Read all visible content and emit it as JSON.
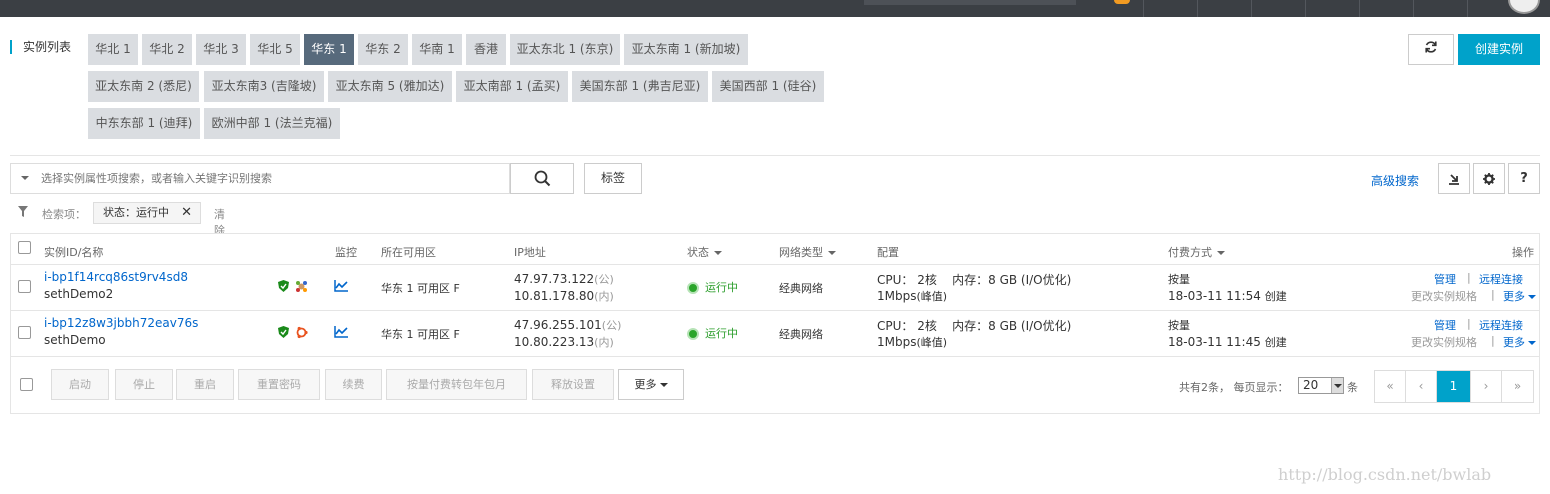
{
  "page_title": "实例列表",
  "regions": [
    {
      "label": "华北 1",
      "active": false
    },
    {
      "label": "华北 2",
      "active": false
    },
    {
      "label": "华北 3",
      "active": false
    },
    {
      "label": "华北 5",
      "active": false
    },
    {
      "label": "华东 1",
      "active": true
    },
    {
      "label": "华东 2",
      "active": false
    },
    {
      "label": "华南 1",
      "active": false
    },
    {
      "label": "香港",
      "active": false
    },
    {
      "label": "亚太东北 1 (东京)",
      "active": false
    },
    {
      "label": "亚太东南 1 (新加坡)",
      "active": false
    },
    {
      "label": "亚太东南 2 (悉尼)",
      "active": false
    },
    {
      "label": "亚太东南3 (吉隆坡)",
      "active": false
    },
    {
      "label": "亚太东南 5 (雅加达)",
      "active": false
    },
    {
      "label": "亚太南部 1 (孟买)",
      "active": false
    },
    {
      "label": "美国东部 1 (弗吉尼亚)",
      "active": false
    },
    {
      "label": "美国西部 1 (硅谷)",
      "active": false
    },
    {
      "label": "中东东部 1 (迪拜)",
      "active": false
    },
    {
      "label": "欧洲中部 1 (法兰克福)",
      "active": false
    }
  ],
  "actions": {
    "create": "创建实例",
    "refresh_icon": "refresh-icon"
  },
  "search": {
    "placeholder": "选择实例属性项搜索，或者输入关键字识别搜索",
    "tag_label": "标签",
    "advanced": "高级搜索"
  },
  "filter": {
    "label": "检索项：",
    "chip": "状态：运行中",
    "clear": "清除"
  },
  "table": {
    "headers": {
      "id_name": "实例ID/名称",
      "monitor": "监控",
      "zone": "所在可用区",
      "ip": "IP地址",
      "status": "状态",
      "network": "网络类型",
      "config": "配置",
      "billing": "付费方式",
      "ops": "操作"
    },
    "rows": [
      {
        "id": "i-bp1f14rcq86st9rv4sd8",
        "name": "sethDemo2",
        "zone": "华东 1 可用区 F",
        "ip_public": "47.97.73.122",
        "ip_public_tag": "(公)",
        "ip_private": "10.81.178.80",
        "ip_private_tag": "(内)",
        "status": "运行中",
        "network": "经典网络",
        "cpu": "CPU： 2核",
        "mem": "内存：8 GB (I/O优化)",
        "bandwidth": "1Mbps",
        "bandwidth_tag": "(峰值)",
        "billing": "按量",
        "created": "18-03-11 11:54",
        "created_tag": "创建",
        "op_manage": "管理",
        "op_remote": "远程连接",
        "op_change": "更改实例规格",
        "op_more": "更多"
      },
      {
        "id": "i-bp12z8w3jbbh72eav76s",
        "name": "sethDemo",
        "zone": "华东 1 可用区 F",
        "ip_public": "47.96.255.101",
        "ip_public_tag": "(公)",
        "ip_private": "10.80.223.13",
        "ip_private_tag": "(内)",
        "status": "运行中",
        "network": "经典网络",
        "cpu": "CPU： 2核",
        "mem": "内存：8 GB (I/O优化)",
        "bandwidth": "1Mbps",
        "bandwidth_tag": "(峰值)",
        "billing": "按量",
        "created": "18-03-11 11:45",
        "created_tag": "创建",
        "op_manage": "管理",
        "op_remote": "远程连接",
        "op_change": "更改实例规格",
        "op_more": "更多"
      }
    ]
  },
  "bulk": {
    "start": "启动",
    "stop": "停止",
    "restart": "重启",
    "reset_pwd": "重置密码",
    "renew": "续费",
    "switch_billing": "按量付费转包年包月",
    "release": "释放设置",
    "more": "更多"
  },
  "pagination": {
    "summary": "共有2条， 每页显示：",
    "page_size": "20",
    "unit": "条",
    "first": "«",
    "prev": "‹",
    "current": "1",
    "next": "›",
    "last": "»"
  },
  "watermark": "http://blog.csdn.net/bwlab",
  "colors": {
    "accent": "#00a2ca",
    "active_region": "#576a7c",
    "link": "#0066cc",
    "running": "#2aa52a"
  }
}
